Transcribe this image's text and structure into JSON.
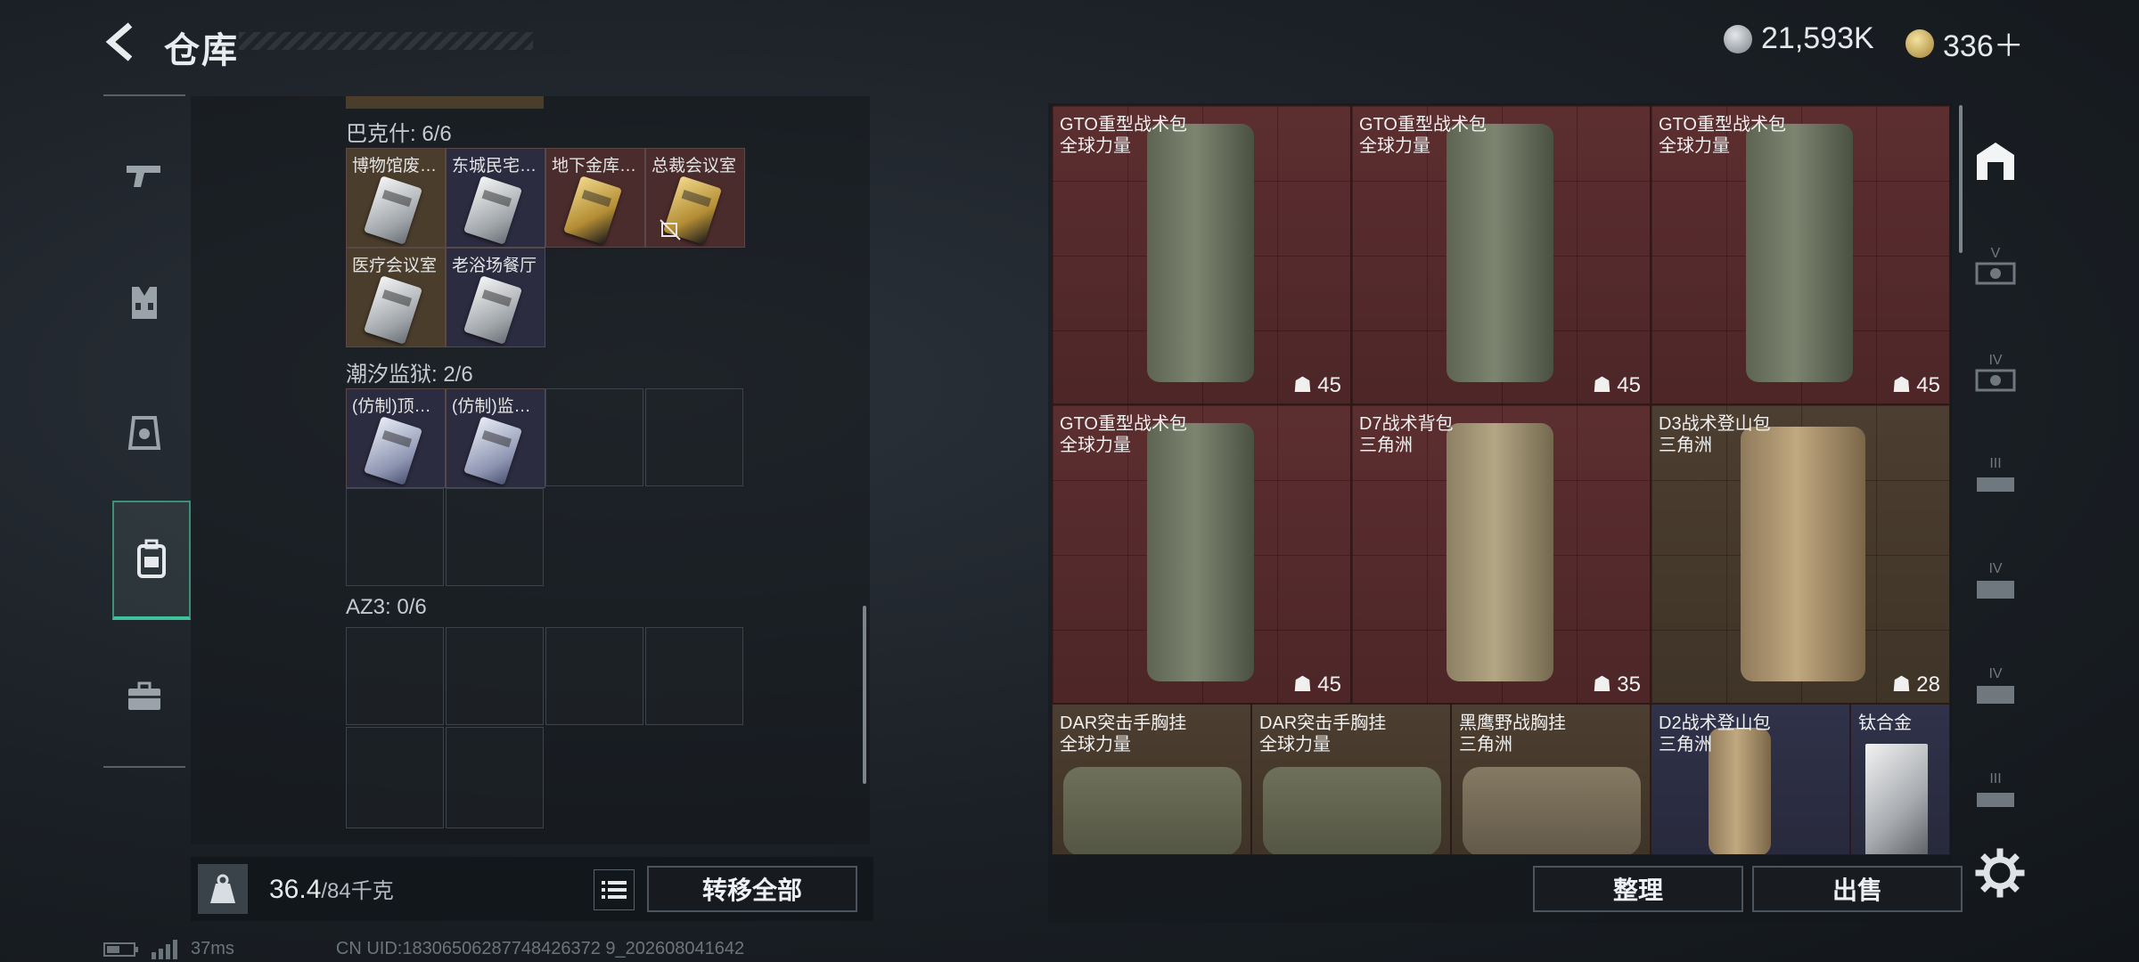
{
  "header": {
    "title": "仓库",
    "currency": [
      {
        "icon": "silver-coin-icon",
        "value": "21,593K"
      },
      {
        "icon": "gold-coin-icon",
        "value": "336＋"
      }
    ]
  },
  "left_rail": [
    {
      "name": "weapons",
      "icon": "gun-icon"
    },
    {
      "name": "armor",
      "icon": "vest-icon"
    },
    {
      "name": "helmet",
      "icon": "helmet-icon"
    },
    {
      "name": "backpack",
      "icon": "backpack-icon",
      "active": true
    },
    {
      "name": "cases",
      "icon": "briefcase-icon"
    }
  ],
  "key_sections": [
    {
      "label": "巴克什: 6/6",
      "keys": [
        "博物馆废…",
        "东城民宅…",
        "地下金库…",
        "总裁会议室",
        "医疗会议室",
        "老浴场餐厅"
      ]
    },
    {
      "label": "潮汐监狱: 2/6",
      "keys": [
        "(仿制)顶…",
        "(仿制)监…"
      ]
    },
    {
      "label": "AZ3: 0/6",
      "keys": []
    }
  ],
  "weight": {
    "current": "36.4",
    "max": "/84千克",
    "icon": "kg-icon"
  },
  "buttons": {
    "transfer_all": "转移全部",
    "organize": "整理",
    "sell": "出售"
  },
  "bags": [
    {
      "name": "GTO重型战术包",
      "origin": "全球力量",
      "capacity": "45",
      "color": "red"
    },
    {
      "name": "GTO重型战术包",
      "origin": "全球力量",
      "capacity": "45",
      "color": "red"
    },
    {
      "name": "GTO重型战术包",
      "origin": "全球力量",
      "capacity": "45",
      "color": "red"
    },
    {
      "name": "GTO重型战术包",
      "origin": "全球力量",
      "capacity": "45",
      "color": "red"
    },
    {
      "name": "D7战术背包",
      "origin": "三角洲",
      "capacity": "35",
      "color": "red"
    },
    {
      "name": "D3战术登山包",
      "origin": "三角洲",
      "capacity": "28",
      "color": "brown"
    },
    {
      "name": "DAR突击手胸挂",
      "origin": "全球力量",
      "capacity": "",
      "color": "brown"
    },
    {
      "name": "DAR突击手胸挂",
      "origin": "全球力量",
      "capacity": "",
      "color": "brown"
    },
    {
      "name": "黑鹰野战胸挂",
      "origin": "三角洲",
      "capacity": "",
      "color": "brown"
    },
    {
      "name": "D2战术登山包",
      "origin": "三角洲",
      "capacity": "",
      "color": "purple"
    },
    {
      "name": "钛合金",
      "origin": "",
      "capacity": "",
      "color": "purple"
    }
  ],
  "right_rail": [
    {
      "name": "warehouse-home",
      "icon": "warehouse-icon",
      "tier": ""
    },
    {
      "name": "tier-v",
      "icon": "storage-tier-icon",
      "tier": "V"
    },
    {
      "name": "tier-iv-a",
      "icon": "storage-tier-icon",
      "tier": "IV"
    },
    {
      "name": "tier-iii-a",
      "icon": "storage-tier-icon",
      "tier": "III"
    },
    {
      "name": "tier-iv-b",
      "icon": "storage-tier-icon",
      "tier": "IV"
    },
    {
      "name": "tier-iv-c",
      "icon": "storage-tier-icon",
      "tier": "IV"
    },
    {
      "name": "tier-iii-b",
      "icon": "storage-tier-icon",
      "tier": "III"
    }
  ],
  "footer": {
    "ping": "37ms",
    "uid": "CN UID:18306506287748426372 9_202608041642"
  },
  "colors": {
    "accent": "#3fc39a",
    "bag_red": "#5c2e30",
    "bag_brown": "#4c3e30",
    "bag_purple": "#30324a"
  }
}
